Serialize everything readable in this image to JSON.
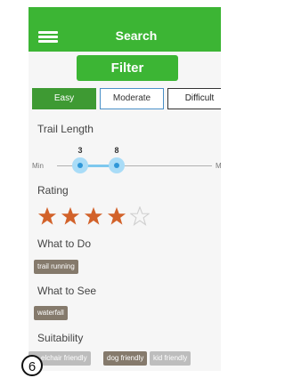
{
  "header": {
    "title": "Search",
    "menu_icon": "hamburger-menu-icon",
    "color": "#3cb534"
  },
  "filter_button": {
    "label": "Filter"
  },
  "difficulty": {
    "options": [
      {
        "label": "Easy",
        "selected": true
      },
      {
        "label": "Moderate",
        "selected": false
      },
      {
        "label": "Difficult",
        "selected": false
      }
    ]
  },
  "trail_length": {
    "label": "Trail Length",
    "min_label": "Min",
    "max_label": "M",
    "low_value": "3",
    "high_value": "8"
  },
  "rating": {
    "label": "Rating",
    "value": 4,
    "max": 5,
    "star_color": "#d2622a"
  },
  "what_to_do": {
    "label": "What to Do",
    "tags": [
      "trail running"
    ]
  },
  "what_to_see": {
    "label": "What to See",
    "tags": [
      "waterfall"
    ]
  },
  "suitability": {
    "label": "Suitability",
    "tags": [
      "elchair friendly",
      "dog friendly",
      "kid friendly"
    ]
  },
  "step_badge": {
    "label": "6"
  }
}
